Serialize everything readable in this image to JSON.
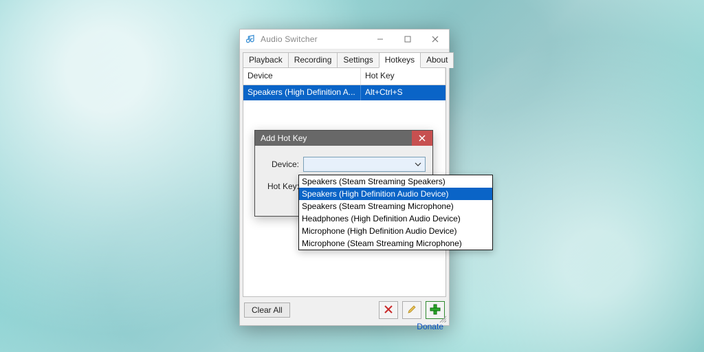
{
  "window": {
    "title": "Audio Switcher",
    "tabs": [
      "Playback",
      "Recording",
      "Settings",
      "Hotkeys",
      "About"
    ],
    "active_tab": 3,
    "columns": {
      "device": "Device",
      "hotkey": "Hot Key"
    },
    "rows": [
      {
        "device": "Speakers (High Definition A...",
        "hotkey": "Alt+Ctrl+S"
      }
    ],
    "clear_all": "Clear All",
    "donate": "Donate"
  },
  "modal": {
    "title": "Add Hot Key",
    "device_label": "Device:",
    "hotkey_label": "Hot Key:"
  },
  "dropdown": {
    "items": [
      "Speakers (Steam Streaming Speakers)",
      "Speakers (High Definition Audio Device)",
      "Speakers (Steam Streaming Microphone)",
      "Headphones (High Definition Audio Device)",
      "Microphone (High Definition Audio Device)",
      "Microphone (Steam Streaming Microphone)"
    ],
    "selected_index": 1
  }
}
